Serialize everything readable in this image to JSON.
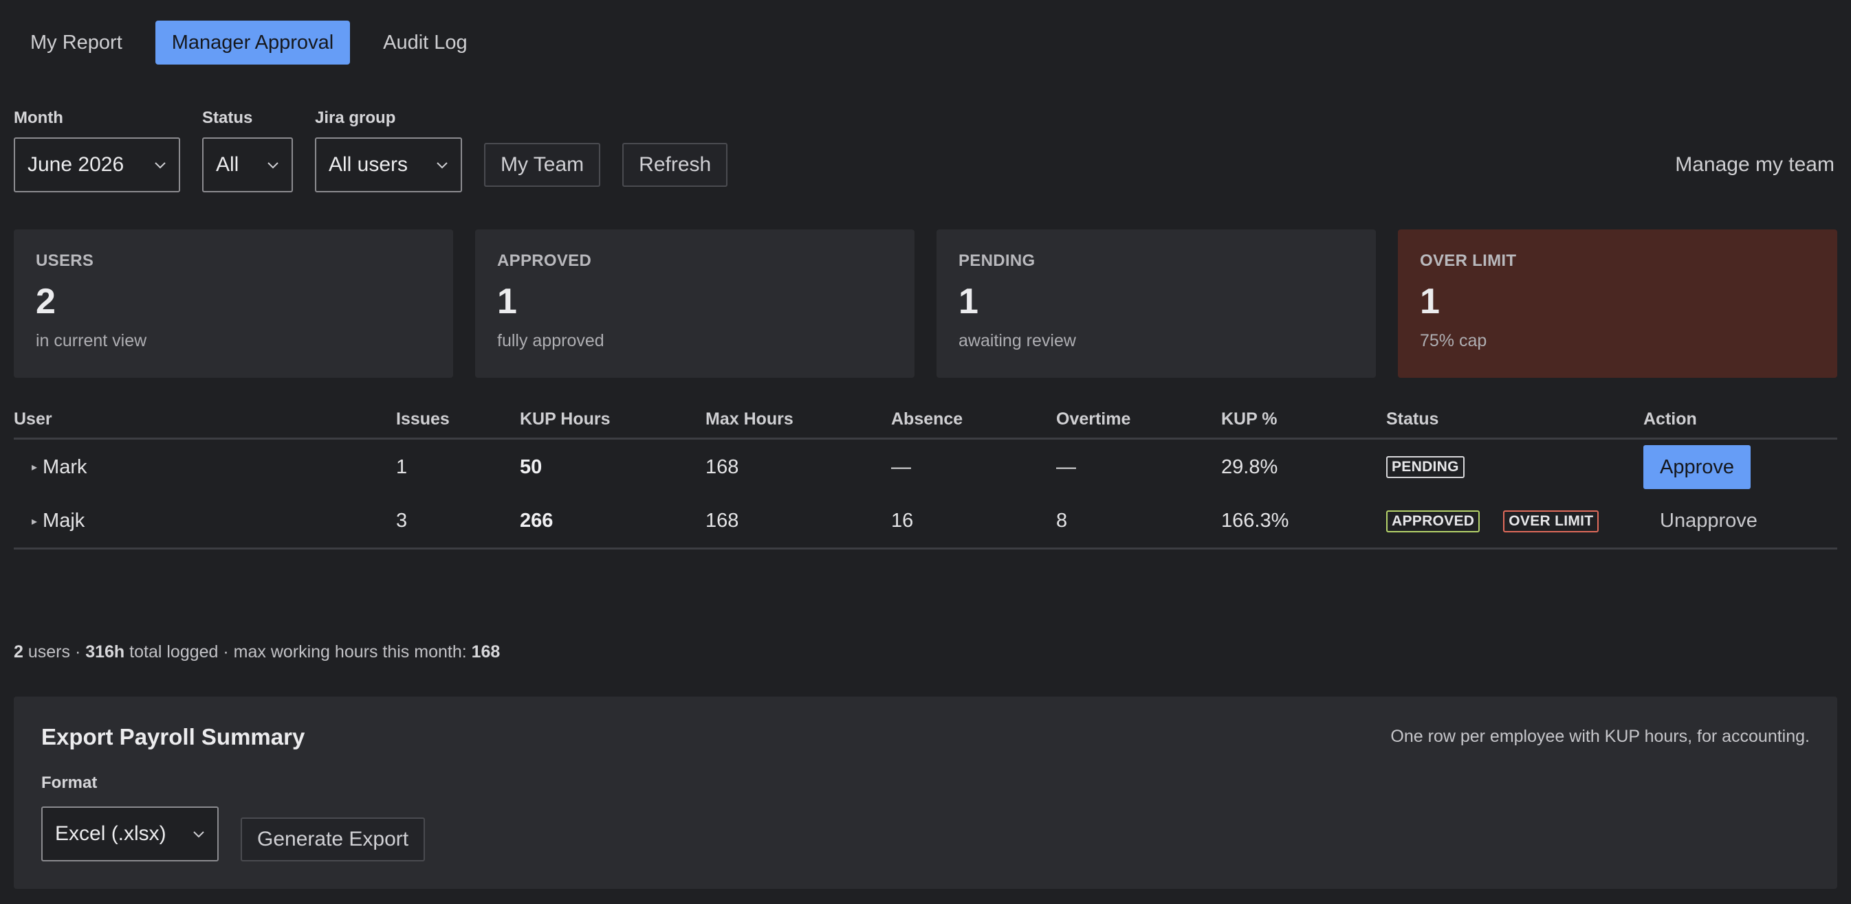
{
  "tabs": [
    {
      "label": "My Report",
      "active": false
    },
    {
      "label": "Manager Approval",
      "active": true
    },
    {
      "label": "Audit Log",
      "active": false
    }
  ],
  "filters": {
    "month": {
      "label": "Month",
      "value": "June 2026"
    },
    "status": {
      "label": "Status",
      "value": "All"
    },
    "jira_group": {
      "label": "Jira group",
      "value": "All users"
    },
    "my_team_label": "My Team",
    "refresh_label": "Refresh",
    "manage_label": "Manage my team"
  },
  "cards": [
    {
      "label": "USERS",
      "value": "2",
      "sub": "in current view"
    },
    {
      "label": "APPROVED",
      "value": "1",
      "sub": "fully approved"
    },
    {
      "label": "PENDING",
      "value": "1",
      "sub": "awaiting review"
    },
    {
      "label": "OVER LIMIT",
      "value": "1",
      "sub": "75% cap"
    }
  ],
  "table": {
    "headers": [
      "User",
      "Issues",
      "KUP Hours",
      "Max Hours",
      "Absence",
      "Overtime",
      "KUP %",
      "Status",
      "Action"
    ],
    "rows": [
      {
        "user": "Mark",
        "issues": "1",
        "kup_hours": "50",
        "max_hours": "168",
        "absence": "—",
        "overtime": "—",
        "kup_pct": "29.8%",
        "status": "PENDING",
        "flag": "",
        "action": "Approve"
      },
      {
        "user": "Majk",
        "issues": "3",
        "kup_hours": "266",
        "max_hours": "168",
        "absence": "16",
        "overtime": "8",
        "kup_pct": "166.3%",
        "status": "APPROVED",
        "flag": "OVER LIMIT",
        "action": "Unapprove"
      }
    ]
  },
  "summary": {
    "users": "2",
    "users_text": "users ·",
    "total": "316h",
    "total_text": "total logged · max working hours this month:",
    "max": "168"
  },
  "export": {
    "title": "Export Payroll Summary",
    "description": "One row per employee with KUP hours, for accounting.",
    "format_label": "Format",
    "format_value": "Excel (.xlsx)",
    "button_label": "Generate Export"
  },
  "colors": {
    "background": "#1f2023",
    "accent": "#669df6",
    "card": "#2b2c30",
    "danger_card": "#4a2722",
    "approved_badge": "#b6d46a",
    "over_badge": "#e06b5b"
  }
}
